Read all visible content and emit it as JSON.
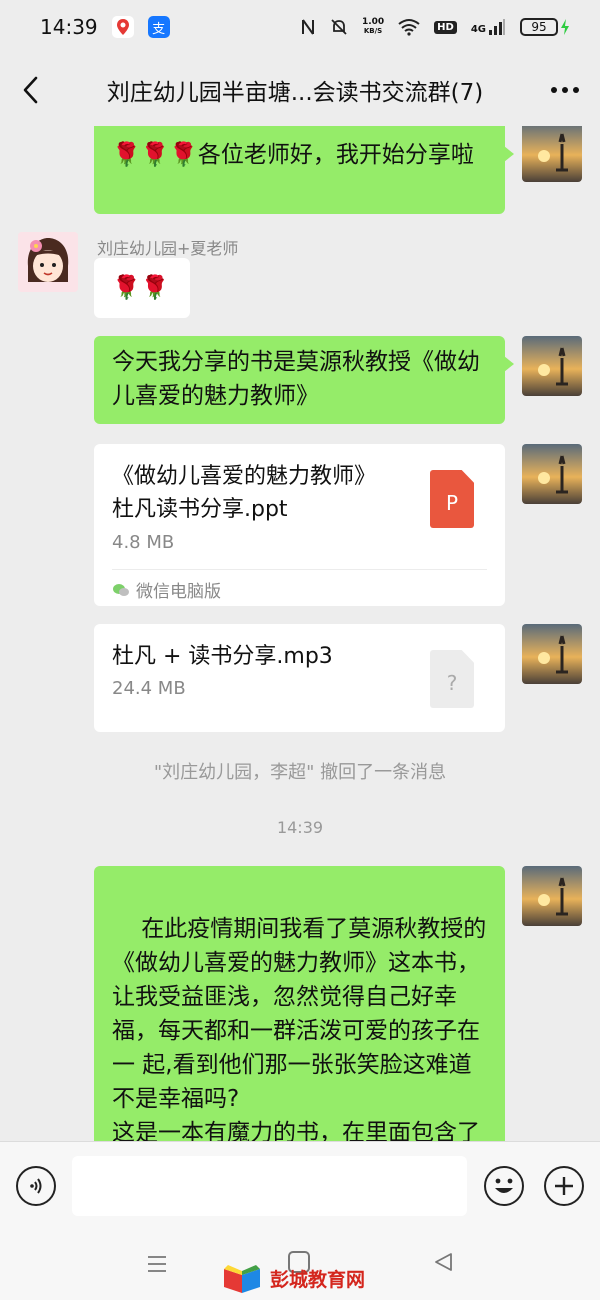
{
  "status_bar": {
    "time": "14:39",
    "net_speed_value": "1.00",
    "net_speed_unit": "KB/S",
    "signal_label": "4G",
    "hd_label": "HD",
    "battery": "95"
  },
  "header": {
    "title": "刘庄幼儿园半亩塘...会读书交流群(7)"
  },
  "messages": {
    "m1_text": "🌹🌹🌹各位老师好，我开始分享啦",
    "m2_sender": "刘庄幼儿园+夏老师",
    "m2_text": "🌹🌹",
    "m3_text": "今天我分享的书是莫源秋教授《做幼儿喜爱的魅力教师》",
    "file1": {
      "name_line1": "《做幼儿喜爱的魅力教师》",
      "name_line2": "杜凡读书分享.ppt",
      "size": "4.8 MB",
      "icon_letter": "P",
      "source": "微信电脑版"
    },
    "file2": {
      "name": "杜凡 + 读书分享.mp3",
      "size": "24.4 MB",
      "icon_letter": "?"
    },
    "recall_note": "\"刘庄幼儿园，李超\" 撤回了一条消息",
    "timestamp": "14:39",
    "m4_text": "在此疫情期间我看了莫源秋教授的《做幼儿喜爱的魅力教师》这本书，让我受益匪浅，忽然觉得自己好幸福，每天都和一群活泼可爱的孩子在一 起,看到他们那一张张笑脸这难道不是幸福吗?\n这是一本有魔力的书，在里面包含了很多的爱。爱应该是幼儿园的一"
  },
  "input": {
    "placeholder": ""
  },
  "watermark": {
    "text": "彭城教育网"
  },
  "colors": {
    "bubble_green": "#95ec69",
    "background": "#ededed",
    "ppt_orange": "#e9573e"
  }
}
